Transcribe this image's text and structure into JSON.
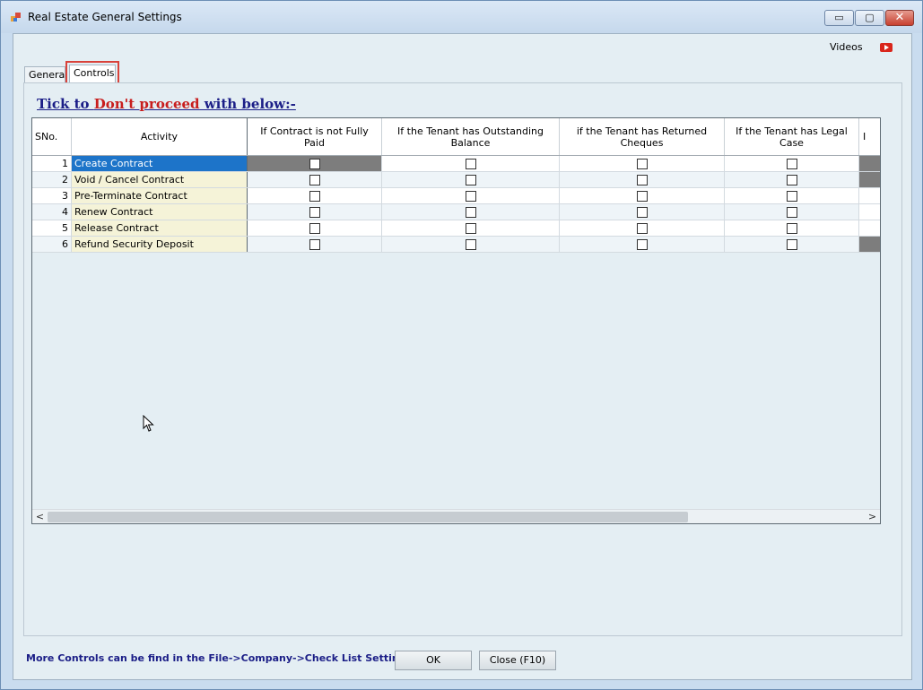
{
  "window": {
    "title": "Real Estate General Settings",
    "controls": {
      "minimize": "▭",
      "maximize": "▢",
      "close": "✕"
    }
  },
  "toolbar": {
    "videos_label": "Videos"
  },
  "tabs": [
    {
      "label": "General",
      "active": false
    },
    {
      "label": "Controls",
      "active": true
    }
  ],
  "heading": {
    "part1": "Tick to ",
    "part2": "Don't proceed",
    "part3": " with below:-"
  },
  "grid": {
    "columns": [
      "SNo.",
      "Activity",
      "If Contract is not Fully Paid",
      "If the Tenant has Outstanding Balance",
      "if the Tenant has Returned Cheques",
      "If the Tenant has Legal Case",
      "I"
    ],
    "rows": [
      {
        "sno": "1",
        "activity": "Create Contract",
        "selected": true,
        "dark_cols": [
          0
        ],
        "stub_dark": true
      },
      {
        "sno": "2",
        "activity": "Void / Cancel Contract",
        "selected": false,
        "dark_cols": [],
        "stub_dark": true
      },
      {
        "sno": "3",
        "activity": "Pre-Terminate Contract",
        "selected": false,
        "dark_cols": [],
        "stub_dark": false
      },
      {
        "sno": "4",
        "activity": "Renew Contract",
        "selected": false,
        "dark_cols": [],
        "stub_dark": false
      },
      {
        "sno": "5",
        "activity": "Release Contract",
        "selected": false,
        "dark_cols": [],
        "stub_dark": false
      },
      {
        "sno": "6",
        "activity": "Refund Security Deposit",
        "selected": false,
        "dark_cols": [],
        "stub_dark": true
      }
    ]
  },
  "footer": {
    "note": "More Controls can be find in the File->Company->Check List Settings",
    "ok_label": "OK",
    "close_label": "Close (F10)"
  },
  "scrollbar": {
    "left_arrow": "<",
    "right_arrow": ">"
  },
  "colors": {
    "accent": "#1d74c9",
    "heading": "#1b1e87",
    "warning": "#c81e1e"
  }
}
